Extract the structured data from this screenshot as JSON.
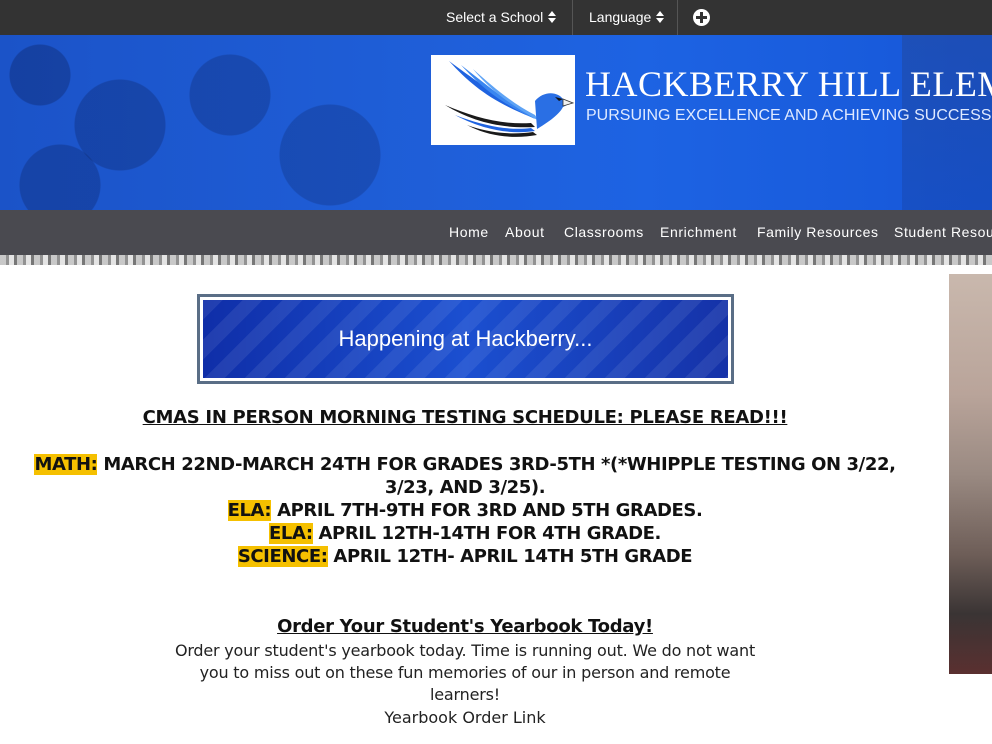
{
  "topbar": {
    "school_label": "Select a School",
    "language_label": "Language",
    "school_icon": "sort-icon",
    "language_icon": "sort-icon",
    "add_icon": "plus-circle-icon"
  },
  "header": {
    "title": "HACKBERRY HILL ELEME",
    "subtitle": "PURSUING EXCELLENCE AND ACHIEVING SUCCESS",
    "logo": "eagle-logo",
    "accent_color": "#1f5fd9"
  },
  "nav": {
    "items": [
      {
        "label": "Home"
      },
      {
        "label": "About"
      },
      {
        "label": "Classrooms"
      },
      {
        "label": "Enrichment"
      },
      {
        "label": "Family Resources"
      },
      {
        "label": "Student Resou"
      }
    ]
  },
  "main": {
    "happening_label": "Happening at Hackberry...",
    "cmas_title": "CMAS IN PERSON MORNING TESTING SCHEDULE: PLEASE READ!!!",
    "schedule": [
      {
        "subject": "MATH:",
        "text": " MARCH 22ND-MARCH 24TH FOR GRADES 3RD-5TH *(*WHIPPLE TESTING ON 3/22, 3/23, AND 3/25)."
      },
      {
        "subject": "ELA:",
        "text": " APRIL 7TH-9TH FOR 3RD AND 5TH GRADES."
      },
      {
        "subject": "ELA:",
        "text": " APRIL 12TH-14TH FOR 4TH GRADE."
      },
      {
        "subject": "SCIENCE:",
        "text": " APRIL 12TH- APRIL 14TH 5TH GRADE"
      }
    ],
    "highlight_color": "#f5c000",
    "yearbook_title": "Order Your Student's Yearbook Today!",
    "yearbook_body": "Order your student's yearbook today.  Time is running out.  We do not want you to miss out on these fun memories of our in person and remote learners!",
    "yearbook_link": "Yearbook Order Link"
  }
}
